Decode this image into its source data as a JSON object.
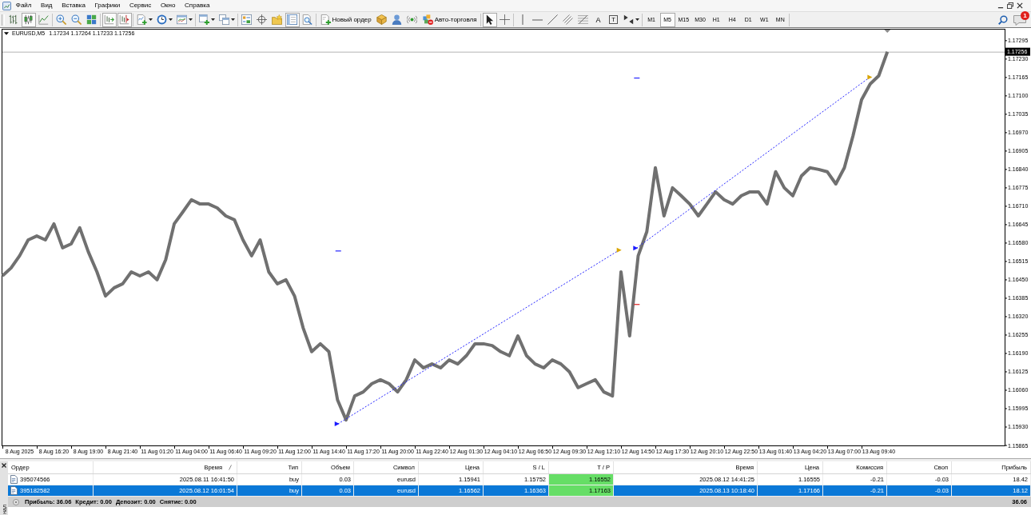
{
  "menu": {
    "items": [
      "Файл",
      "Вид",
      "Вставка",
      "Графики",
      "Сервис",
      "Окно",
      "Справка"
    ]
  },
  "toolbar": {
    "groups": [
      [
        {
          "kind": "bar_chart",
          "selected": false,
          "dropdown": false
        },
        {
          "kind": "candlesticks",
          "selected": true,
          "dropdown": false
        },
        {
          "kind": "line_chart",
          "selected": false,
          "dropdown": false
        }
      ],
      [
        {
          "kind": "zoom_in",
          "selected": false,
          "dropdown": false
        },
        {
          "kind": "zoom_out",
          "selected": false,
          "dropdown": false
        },
        {
          "kind": "tile_windows",
          "selected": false,
          "dropdown": false
        }
      ],
      [
        {
          "kind": "auto_scroll",
          "selected": true,
          "dropdown": false
        },
        {
          "kind": "chart_shift",
          "selected": true,
          "dropdown": false
        }
      ],
      [
        {
          "kind": "indicators",
          "selected": false,
          "dropdown": true
        },
        {
          "kind": "periods",
          "selected": false,
          "dropdown": true
        },
        {
          "kind": "templates",
          "selected": false,
          "dropdown": true
        }
      ],
      [
        {
          "kind": "new_chart",
          "selected": false,
          "dropdown": true
        },
        {
          "kind": "profiles",
          "selected": false,
          "dropdown": true
        }
      ],
      [
        {
          "kind": "navigator",
          "selected": false,
          "dropdown": false
        },
        {
          "kind": "data_window",
          "selected": false,
          "dropdown": false
        },
        {
          "kind": "favorites",
          "selected": false,
          "dropdown": false
        },
        {
          "kind": "terminal",
          "selected": true,
          "dropdown": false
        },
        {
          "kind": "strategy_tester",
          "selected": false,
          "dropdown": false
        }
      ],
      [
        {
          "kind": "new_order",
          "label": "Новый ордер",
          "selected": false,
          "dropdown": false
        },
        {
          "kind": "metaeditor",
          "selected": false,
          "dropdown": false
        },
        {
          "kind": "community",
          "selected": false,
          "dropdown": false
        },
        {
          "kind": "signals",
          "selected": false,
          "dropdown": false
        },
        {
          "kind": "auto_trading",
          "label": "Авто-торговля",
          "selected": false,
          "dropdown": false
        }
      ],
      [
        {
          "kind": "cursor",
          "selected": true,
          "dropdown": false
        },
        {
          "kind": "crosshair",
          "selected": false,
          "dropdown": false
        }
      ],
      [
        {
          "kind": "vertical_line",
          "selected": false,
          "dropdown": false
        },
        {
          "kind": "horizontal_line",
          "selected": false,
          "dropdown": false
        },
        {
          "kind": "trend_line",
          "selected": false,
          "dropdown": false
        },
        {
          "kind": "channel",
          "selected": false,
          "dropdown": false
        },
        {
          "kind": "fibonacci",
          "selected": false,
          "dropdown": false
        },
        {
          "kind": "text",
          "label": "A",
          "selected": false,
          "dropdown": false
        },
        {
          "kind": "text_label",
          "label": "T",
          "selected": false,
          "dropdown": false
        },
        {
          "kind": "arrows",
          "selected": false,
          "dropdown": true
        }
      ]
    ],
    "timeframes": [
      {
        "label": "M1",
        "selected": false
      },
      {
        "label": "M5",
        "selected": true
      },
      {
        "label": "M15",
        "selected": false
      },
      {
        "label": "M30",
        "selected": false
      },
      {
        "label": "H1",
        "selected": false
      },
      {
        "label": "H4",
        "selected": false
      },
      {
        "label": "D1",
        "selected": false
      },
      {
        "label": "W1",
        "selected": false
      },
      {
        "label": "MN",
        "selected": false
      }
    ],
    "notifications": {
      "count": "1"
    }
  },
  "chart": {
    "quote": "1.17234 1.17264 1.17233 1.17256",
    "chart_data": {
      "type": "line",
      "title": "EURUSD,M5",
      "categories": [
        null,
        null,
        "8 Aug 2025",
        null,
        null,
        null,
        "8 Aug 16:20",
        null,
        null,
        null,
        "8 Aug 19:00",
        null,
        null,
        null,
        "8 Aug 21:40",
        null,
        null,
        null,
        "11 Aug 01:20",
        null,
        null,
        null,
        "11 Aug 04:00",
        null,
        null,
        null,
        "11 Aug 06:40",
        null,
        null,
        null,
        "11 Aug 09:20",
        null,
        null,
        null,
        "11 Aug 12:00",
        null,
        null,
        null,
        "11 Aug 14:40",
        null,
        null,
        null,
        "11 Aug 17:20",
        null,
        null,
        null,
        "11 Aug 20:00",
        null,
        null,
        null,
        "11 Aug 22:40",
        null,
        null,
        null,
        "12 Aug 01:30",
        null,
        null,
        null,
        "12 Aug 04:10",
        null,
        null,
        null,
        "12 Aug 06:50",
        null,
        null,
        null,
        "12 Aug 09:30",
        null,
        null,
        null,
        "12 Aug 12:10",
        null,
        null,
        null,
        "12 Aug 14:50",
        null,
        null,
        null,
        "12 Aug 17:30",
        null,
        null,
        null,
        "12 Aug 20:10",
        null,
        null,
        null,
        "12 Aug 22:50",
        null,
        null,
        null,
        "13 Aug 01:40",
        null,
        null,
        null,
        "13 Aug 04:20",
        null,
        null,
        null,
        "13 Aug 07:00",
        null,
        null,
        null,
        "13 Aug 09:40",
        null
      ],
      "values": [
        1.16464,
        1.16492,
        1.16535,
        1.16591,
        1.16605,
        1.16591,
        1.16648,
        1.16563,
        1.16577,
        1.16634,
        1.16549,
        1.16478,
        1.16393,
        1.16422,
        1.16436,
        1.16478,
        1.16464,
        1.16478,
        1.1645,
        1.16521,
        1.16648,
        1.1669,
        1.16733,
        1.16718,
        1.16718,
        1.16704,
        1.16676,
        1.16662,
        1.16591,
        1.16535,
        1.16591,
        1.16478,
        1.16436,
        1.1645,
        1.16393,
        1.1628,
        1.16196,
        1.16224,
        1.16196,
        1.16026,
        1.15955,
        1.1604,
        1.16054,
        1.16083,
        1.16097,
        1.16083,
        1.16054,
        1.16097,
        1.16167,
        1.16139,
        1.16153,
        1.16139,
        1.16167,
        1.16153,
        1.16182,
        1.16224,
        1.16224,
        1.16218,
        1.16196,
        1.16182,
        1.16252,
        1.16182,
        1.16153,
        1.16139,
        1.16167,
        1.16153,
        1.16125,
        1.16069,
        1.16083,
        1.16097,
        1.16054,
        1.1604,
        1.16478,
        1.16252,
        1.16535,
        1.1662,
        1.16846,
        1.16676,
        1.16775,
        1.16747,
        1.16718,
        1.16676,
        1.16718,
        1.16761,
        1.16733,
        1.16718,
        1.16747,
        1.16761,
        1.16761,
        1.16718,
        1.16832,
        1.16775,
        1.16747,
        1.16817,
        1.16846,
        1.1684,
        1.16832,
        1.16789,
        1.16846,
        1.16959,
        1.17086,
        1.17142,
        1.17171,
        1.17256
      ],
      "ylim": [
        1.15865,
        1.17337
      ],
      "yticks": [
        {
          "value": 1.17295,
          "label": "1.17295"
        },
        {
          "value": 1.1723,
          "label": "1.17230"
        },
        {
          "value": 1.17165,
          "label": "1.17165"
        },
        {
          "value": 1.171,
          "label": "1.17100"
        },
        {
          "value": 1.17035,
          "label": "1.17035"
        },
        {
          "value": 1.1697,
          "label": "1.16970"
        },
        {
          "value": 1.16905,
          "label": "1.16905"
        },
        {
          "value": 1.1684,
          "label": "1.16840"
        },
        {
          "value": 1.16775,
          "label": "1.16775"
        },
        {
          "value": 1.1671,
          "label": "1.16710"
        },
        {
          "value": 1.16645,
          "label": "1.16645"
        },
        {
          "value": 1.1658,
          "label": "1.16580"
        },
        {
          "value": 1.16515,
          "label": "1.16515"
        },
        {
          "value": 1.1645,
          "label": "1.16450"
        },
        {
          "value": 1.16385,
          "label": "1.16385"
        },
        {
          "value": 1.1632,
          "label": "1.16320"
        },
        {
          "value": 1.16255,
          "label": "1.16255"
        },
        {
          "value": 1.1619,
          "label": "1.16190"
        },
        {
          "value": 1.16125,
          "label": "1.16125"
        },
        {
          "value": 1.1606,
          "label": "1.16060"
        },
        {
          "value": 1.15995,
          "label": "1.15995"
        },
        {
          "value": 1.1593,
          "label": "1.15930"
        },
        {
          "value": 1.15865,
          "label": "1.15865"
        }
      ],
      "ref_lines": [
        {
          "axis": "y",
          "value": 1.17256,
          "label": "1.17256"
        }
      ]
    }
  },
  "terminal": {
    "tab": "нал",
    "columns": [
      {
        "label": "Ордер",
        "sorted": false
      },
      {
        "label": "Время",
        "sorted": true
      },
      {
        "label": "Тип",
        "sorted": false
      },
      {
        "label": "Объем",
        "sorted": false
      },
      {
        "label": "Символ",
        "sorted": false
      },
      {
        "label": "Цена",
        "sorted": false
      },
      {
        "label": "S / L",
        "sorted": false
      },
      {
        "label": "T / P",
        "sorted": false
      },
      {
        "label": "Время",
        "sorted": false
      },
      {
        "label": "Цена",
        "sorted": false
      },
      {
        "label": "Комиссия",
        "sorted": false
      },
      {
        "label": "Своп",
        "sorted": false
      },
      {
        "label": "Прибыль",
        "sorted": false
      }
    ],
    "rows": [
      {
        "selected": false,
        "tp_triggered": true,
        "cells": [
          "395074566",
          "2025.08.11 16:41:50",
          "buy",
          "0.03",
          "eurusd",
          "1.15941",
          "1.15752",
          "1.16552",
          "2025.08.12 14:41:25",
          "1.16555",
          "-0.21",
          "-0.03",
          "18.42"
        ]
      },
      {
        "selected": true,
        "tp_triggered": true,
        "cells": [
          "395182582",
          "2025.08.12 16:01:54",
          "buy",
          "0.03",
          "eurusd",
          "1.16562",
          "1.16363",
          "1.17163",
          "2025.08.13 10:18:40",
          "1.17166",
          "-0.21",
          "-0.03",
          "18.12"
        ]
      }
    ],
    "summary": {
      "items": [
        "Прибыль: 36.06",
        "Кредит: 0.00",
        "Депозит: 0.00",
        "Снятие: 0.00"
      ],
      "total": "36.06"
    }
  }
}
